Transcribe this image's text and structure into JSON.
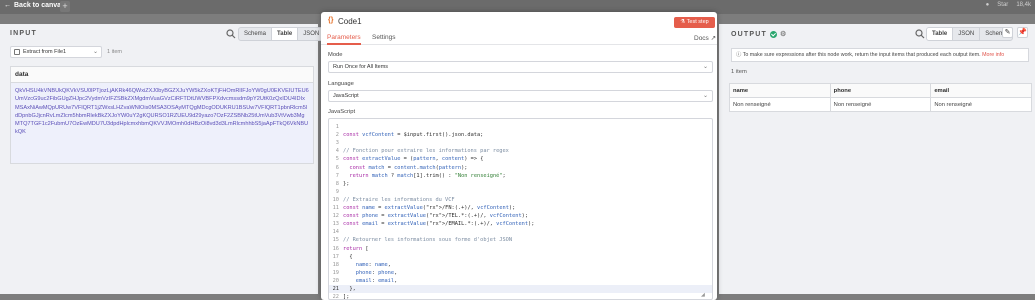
{
  "topbar": {
    "back_label": "Back to canvas",
    "plus": "+",
    "star_label": "Star",
    "count": "18,4k"
  },
  "input": {
    "title": "INPUT",
    "tabs": [
      "Schema",
      "Table",
      "JSON"
    ],
    "active_tab": "Table",
    "source_select": "Extract from File1",
    "item_count": "1 item",
    "column": "data",
    "cell_value": "QkVHSU4kVNBUkQKVkVSU0lPTjozLjAKRk46QWxiZXJ0byBGZXJuYW5kZXoKTjFHOmRlIFJoYW0gU0EKVEIUTEU6UmVzcG9uc2FibGUgZHJpc2VydmVzIFZSBkZXMgdmVuaGVzCiRFTDtUWVBFPXdvcmssdm9pY2UtK0zQxIDU4IDIxMSAxNiAwMQpURUw7VFlQRT1jZWxsLHZvaWNlOis0MSA3OSAyMTQgMDcgODUKRU1BSUw7VFlQRT1pbnRlcm5ldDpnbGJjcnRvLmZlcm5hbmRlekBkZXJoYW0uY2gKQURSO1RZUEU9d29yazo7OzF2ZSBNb25tUmVub3VtVwb3MgMTQ7TGF1c2FubmU7OzEwMDU7U3dpdHplcmxhbmQKVVJMOmh0dHBzOi8vd3d3LmRlcmhhbS5jaApFTkQ6VkNBUkQK"
  },
  "modal": {
    "title": "Code1",
    "test_step": "Test step",
    "tabs": {
      "parameters": "Parameters",
      "settings": "Settings",
      "docs": "Docs"
    },
    "mode_label": "Mode",
    "mode_value": "Run Once for All Items",
    "language_label": "Language",
    "language_value": "JavaScript",
    "code_label": "JavaScript",
    "active_line": 21,
    "code_lines": [
      "",
      "const vcfContent = $input.first().json.data;",
      "",
      "// Fonction pour extraire les informations par regex",
      "const extractValue = (pattern, content) => {",
      "  const match = content.match(pattern);",
      "  return match ? match[1].trim() : \"Non renseigné\";",
      "};",
      "",
      "// Extraire les informations du VCF",
      "const name = extractValue(/FN:(.+)/, vcfContent);",
      "const phone = extractValue(/TEL.*:(.+)/, vcfContent);",
      "const email = extractValue(/EMAIL.*:(.+)/, vcfContent);",
      "",
      "// Retourner les informations sous forme d'objet JSON",
      "return [",
      "  {",
      "    name: name,",
      "    phone: phone,",
      "    email: email,",
      "  },",
      "];",
      ""
    ]
  },
  "output": {
    "title": "OUTPUT",
    "tabs": [
      "Table",
      "JSON",
      "Schema"
    ],
    "active_tab": "Table",
    "notice": "To make sure expressions after this node work, return the input items that produced each output item.",
    "notice_link": "More info",
    "item_count": "1 item",
    "columns": [
      "name",
      "phone",
      "email"
    ],
    "rows": [
      [
        "Non renseigné",
        "Non renseigné",
        "Non renseigné"
      ]
    ]
  },
  "colors": {
    "accent": "#e55d4b",
    "success": "#2aa66e",
    "data_text": "#5b4fb8"
  }
}
